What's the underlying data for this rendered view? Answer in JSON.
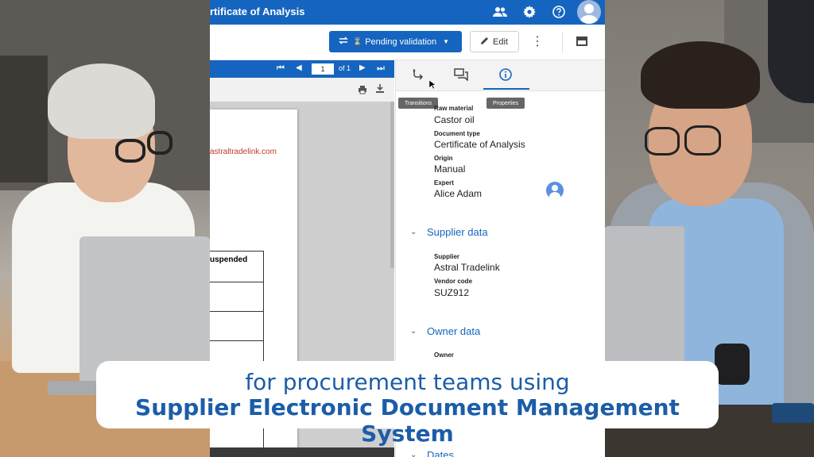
{
  "appbar": {
    "title": "rtificate of Analysis",
    "icons": [
      "people-icon",
      "gear-icon",
      "help-icon",
      "account-avatar"
    ]
  },
  "toolbar": {
    "status_label": "Pending validation",
    "edit_label": "Edit"
  },
  "viewer": {
    "page_number": "1",
    "page_of": "of 1",
    "doc_link_text": "astraltradelink.com",
    "doc_table_header": "uspended"
  },
  "panel": {
    "tooltips": {
      "transitions": "Transitions",
      "properties": "Properties"
    },
    "properties": [
      {
        "label": "Raw material",
        "value": "Castor oil"
      },
      {
        "label": "Document type",
        "value": "Certificate of Analysis"
      },
      {
        "label": "Origin",
        "value": "Manual"
      },
      {
        "label": "Expert",
        "value": "Alice Adam"
      }
    ],
    "supplier_section": "Supplier data",
    "supplier_fields": [
      {
        "label": "Supplier",
        "value": "Astral Tradelink"
      },
      {
        "label": "Vendor code",
        "value": "SUZ912"
      }
    ],
    "owner_section": "Owner data",
    "owner_label": "Owner",
    "dates_section": "Dates"
  },
  "caption": {
    "line1": "for procurement teams using",
    "line2": "Supplier Electronic Document Management System"
  },
  "colors": {
    "brand_blue": "#1565c0",
    "caption_text": "#1c5da8"
  }
}
